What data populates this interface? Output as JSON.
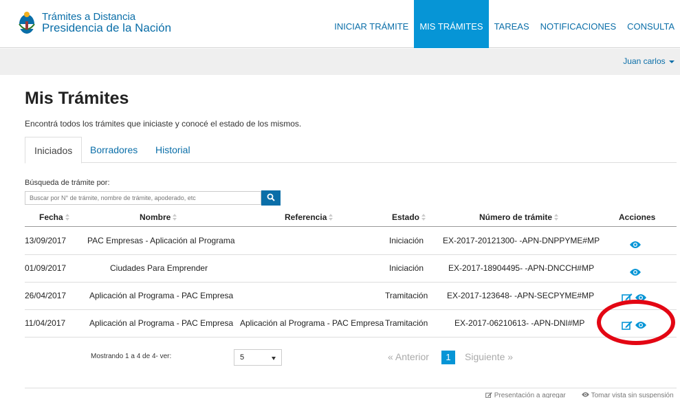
{
  "brand": {
    "line1": "Trámites a Distancia",
    "line2": "Presidencia de la Nación"
  },
  "nav": {
    "items": [
      {
        "label": "INICIAR TRÁMITE"
      },
      {
        "label": "MIS TRÁMITES"
      },
      {
        "label": "TAREAS"
      },
      {
        "label": "NOTIFICACIONES"
      },
      {
        "label": "CONSULTA"
      }
    ],
    "active": "MIS TRÁMITES"
  },
  "user": {
    "name": "Juan carlos"
  },
  "page": {
    "title": "Mis Trámites",
    "subtitle": "Encontrá todos los trámites que iniciaste y conocé el estado de los mismos."
  },
  "tabs": [
    {
      "label": "Iniciados"
    },
    {
      "label": "Borradores"
    },
    {
      "label": "Historial"
    }
  ],
  "search": {
    "label": "Búsqueda de trámite por:",
    "placeholder": "Buscar por N° de trámite, nombre de trámite, apoderado, etc"
  },
  "table": {
    "headers": {
      "fecha": "Fecha",
      "nombre": "Nombre",
      "referencia": "Referencia",
      "estado": "Estado",
      "numero": "Número de trámite",
      "acciones": "Acciones"
    },
    "rows": [
      {
        "fecha": "13/09/2017",
        "nombre": "PAC Empresas - Aplicación al Programa",
        "referencia": "",
        "estado": "Iniciación",
        "numero": "EX-2017-20121300- -APN-DNPPYME#MP",
        "editable": false
      },
      {
        "fecha": "01/09/2017",
        "nombre": "Ciudades Para Emprender",
        "referencia": "",
        "estado": "Iniciación",
        "numero": "EX-2017-18904495- -APN-DNCCH#MP",
        "editable": false
      },
      {
        "fecha": "26/04/2017",
        "nombre": "Aplicación al Programa - PAC Empresa",
        "referencia": "",
        "estado": "Tramitación",
        "numero": "EX-2017-123648- -APN-SECPYME#MP",
        "editable": true
      },
      {
        "fecha": "11/04/2017",
        "nombre": "Aplicación al Programa - PAC Empresa",
        "referencia": "Aplicación al Programa - PAC Empresa",
        "estado": "Tramitación",
        "numero": "EX-2017-06210613- -APN-DNI#MP",
        "editable": true
      }
    ]
  },
  "pagination": {
    "showing": "Mostrando 1 a 4 de 4- ver:",
    "page_size": "5",
    "prev": "« Anterior",
    "current": "1",
    "next": "Siguiente »"
  },
  "footer": {
    "link1": "Presentación a agregar",
    "link2": "Tomar vista sin suspensión"
  },
  "colors": {
    "primary": "#0a6ea8",
    "nav_active": "#0695d6",
    "highlight": "#e30613"
  },
  "icons": {
    "view": "eye-icon",
    "edit": "edit-icon",
    "search": "search-icon"
  }
}
